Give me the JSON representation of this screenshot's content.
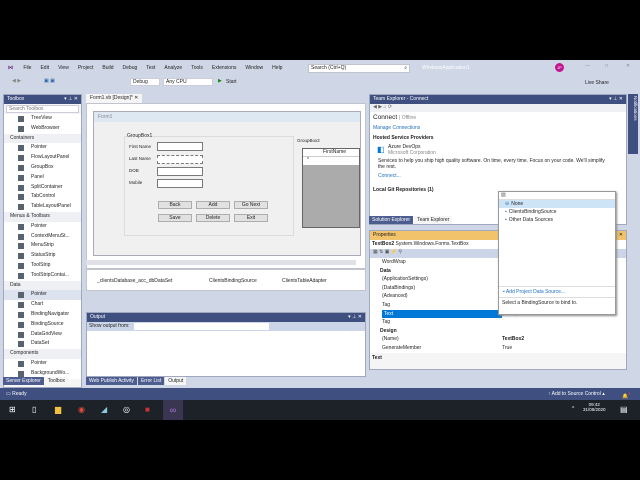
{
  "menu": [
    "File",
    "Edit",
    "View",
    "Project",
    "Build",
    "Debug",
    "Test",
    "Analyze",
    "Tools",
    "Extensions",
    "Window",
    "Help"
  ],
  "search_placeholder": "Search (Ctrl+Q)",
  "solution_name": "WindowsApplication1",
  "avatar": "JP",
  "toolbar": {
    "config": "Debug",
    "platform": "Any CPU",
    "start": "Start",
    "live_share": "Live Share"
  },
  "toolbox": {
    "title": "Toolbox",
    "search": "Search Toolbox",
    "items": [
      {
        "t": "i",
        "l": "TreeView"
      },
      {
        "t": "i",
        "l": "WebBrowser"
      },
      {
        "t": "c",
        "l": "Containers"
      },
      {
        "t": "i",
        "l": "Pointer"
      },
      {
        "t": "i",
        "l": "FlowLayoutPanel"
      },
      {
        "t": "i",
        "l": "GroupBox"
      },
      {
        "t": "i",
        "l": "Panel"
      },
      {
        "t": "i",
        "l": "SplitContainer"
      },
      {
        "t": "i",
        "l": "TabControl"
      },
      {
        "t": "i",
        "l": "TableLayoutPanel"
      },
      {
        "t": "c",
        "l": "Menus & Toolbars"
      },
      {
        "t": "i",
        "l": "Pointer"
      },
      {
        "t": "i",
        "l": "ContextMenuSt..."
      },
      {
        "t": "i",
        "l": "MenuStrip"
      },
      {
        "t": "i",
        "l": "StatusStrip"
      },
      {
        "t": "i",
        "l": "ToolStrip"
      },
      {
        "t": "i",
        "l": "ToolStripContai..."
      },
      {
        "t": "c",
        "l": "Data"
      },
      {
        "t": "i",
        "l": "Pointer"
      },
      {
        "t": "i",
        "l": "Chart"
      },
      {
        "t": "i",
        "l": "BindingNavigator"
      },
      {
        "t": "i",
        "l": "BindingSource"
      },
      {
        "t": "i",
        "l": "DataGridView"
      },
      {
        "t": "i",
        "l": "DataSet"
      },
      {
        "t": "c",
        "l": "Components"
      },
      {
        "t": "i",
        "l": "Pointer"
      },
      {
        "t": "i",
        "l": "BackgroundWo..."
      }
    ],
    "tabs": [
      "Server Explorer",
      "Toolbox"
    ]
  },
  "designer": {
    "tab": "Form1.vb [Design]*",
    "form_title": "Form1",
    "groupbox1": "GroupBox1",
    "groupbox2": "GroupBox2",
    "labels": [
      "First Name",
      "Last Name",
      "DOB",
      "Mobile"
    ],
    "buttons": [
      "Back",
      "Add",
      "Go Next",
      "Save",
      "Delete",
      "Exit"
    ],
    "grid_col": "FirstName",
    "grid_row_marker": "*",
    "components": [
      "_clientsDatabase_acc_dbDataSet",
      "ClientsBindingSource",
      "ClientsTableAdapter"
    ]
  },
  "output": {
    "title": "Output",
    "show_from": "Show output from:"
  },
  "bottom_tabs": [
    "Web Publish Activity",
    "Error List",
    "Output"
  ],
  "team": {
    "title": "Team Explorer - Connect",
    "connect": "Connect",
    "offline": "Offline",
    "manage": "Manage Connections",
    "hosted": "Hosted Service Providers",
    "azure": "Azure DevOps",
    "ms": "Microsoft Corporation",
    "desc": "Services to help you ship high quality software. On time, every time. Focus on your code. We'll simplify the rest.",
    "connect_link": "Connect...",
    "local_git": "Local Git Repositories (1)",
    "tabs": [
      "Solution Explorer",
      "Team Explorer"
    ]
  },
  "props": {
    "title": "Properties",
    "object": "TextBox2",
    "type": "System.Windows.Forms.TextBox",
    "rows": [
      {
        "n": "WordWrap",
        "v": ""
      },
      {
        "n": "Data",
        "v": "",
        "b": 1
      },
      {
        "n": "(ApplicationSettings)",
        "v": ""
      },
      {
        "n": "(DataBindings)",
        "v": ""
      },
      {
        "n": "(Advanced)",
        "v": ""
      },
      {
        "n": "Tag",
        "v": ""
      },
      {
        "n": "Text",
        "v": "(none)",
        "sel": 1
      },
      {
        "n": "Tag",
        "v": ""
      },
      {
        "n": "Design",
        "v": "",
        "b": 1
      },
      {
        "n": "(Name)",
        "v": "TextBox2"
      },
      {
        "n": "GenerateMember",
        "v": "True"
      }
    ],
    "desc_title": "Text"
  },
  "popup": {
    "items": [
      "None",
      "ClientsBindingSource",
      "Other Data Sources"
    ],
    "add": "Add Project Data Source...",
    "hint": "Select a BindingSource to bind to."
  },
  "status": {
    "ready": "Ready",
    "source_control": "Add to Source Control",
    "notif_count": "1"
  },
  "notifications_strip": "Notifications",
  "taskbar": {
    "time": "09:42",
    "date": "31/08/2020"
  }
}
